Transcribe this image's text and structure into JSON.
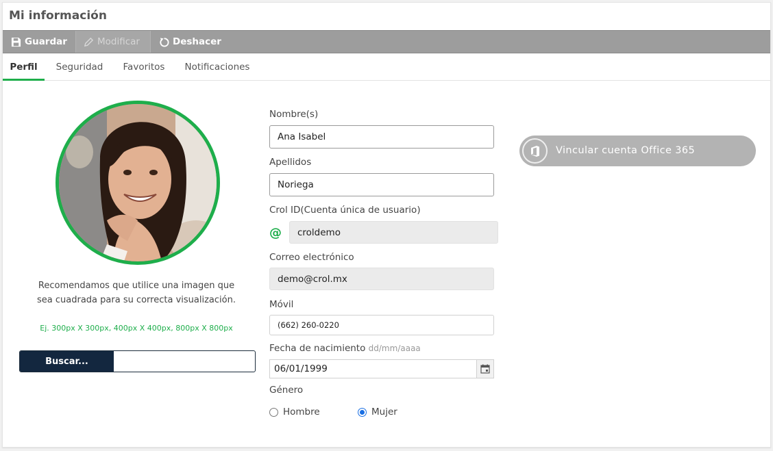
{
  "page": {
    "title": "Mi información"
  },
  "toolbar": {
    "save": "Guardar",
    "edit": "Modificar",
    "undo": "Deshacer"
  },
  "tabs": [
    "Perfil",
    "Seguridad",
    "Favoritos",
    "Notificaciones"
  ],
  "active_tab": "Perfil",
  "photo": {
    "hint": "Recomendamos que utilice una imagen que sea cuadrada para su correcta visualización.",
    "example": "Ej. 300px X 300px, 400px X 400px, 800px X 800px",
    "browse": "Buscar..."
  },
  "form": {
    "first_name": {
      "label": "Nombre(s)",
      "value": "Ana Isabel"
    },
    "last_name": {
      "label": "Apellidos",
      "value": "Noriega"
    },
    "crol_id": {
      "label": "Crol ID(Cuenta única de usuario)",
      "prefix": "@",
      "value": "croldemo"
    },
    "email": {
      "label": "Correo electrónico",
      "value": "demo@crol.mx"
    },
    "mobile": {
      "label": "Móvil",
      "value": "(662) 260-0220"
    },
    "birthdate": {
      "label": "Fecha de nacimiento",
      "format": "dd/mm/aaaa",
      "value": "06/01/1999"
    },
    "gender": {
      "label": "Género",
      "options": [
        "Hombre",
        "Mujer"
      ],
      "selected": "Mujer"
    }
  },
  "office365": {
    "label": "Vincular cuenta Office 365"
  },
  "colors": {
    "accent": "#1eae4b",
    "toolbar": "#9d9d9d",
    "browse_button": "#13273f",
    "office_button": "#b3b3b3"
  }
}
